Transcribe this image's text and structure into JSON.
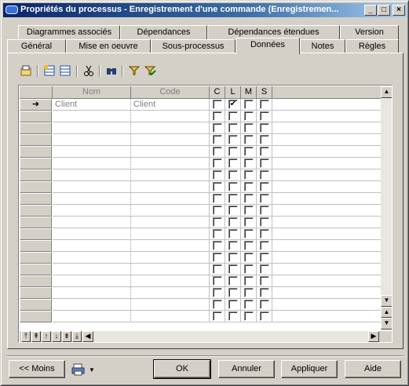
{
  "window": {
    "title": "Propriétés du processus - Enregistrement d'une commande (Enregistremen...",
    "minimize": "_",
    "maximize": "□",
    "close": "×"
  },
  "tabs": {
    "row1": [
      "Diagrammes associés",
      "Dépendances",
      "Dépendances étendues",
      "Version"
    ],
    "row2": [
      "Général",
      "Mise en oeuvre",
      "Sous-processus",
      "Données",
      "Notes",
      "Règles"
    ],
    "active": "Données"
  },
  "toolbar": {
    "icons": [
      "properties-icon",
      "add-rows-icon",
      "insert-row-icon",
      "cut-icon",
      "find-icon",
      "filter-icon",
      "check-filter-icon"
    ]
  },
  "grid": {
    "columns": {
      "nom": "Nom",
      "code": "Code",
      "c": "C",
      "l": "L",
      "m": "M",
      "s": "S"
    },
    "rows": [
      {
        "marker": "➜",
        "nom": "Client",
        "code": "Client",
        "c": false,
        "l": true,
        "m": false,
        "s": false
      }
    ],
    "empty_rows": 18
  },
  "buttons": {
    "less": "<< Moins",
    "ok": "OK",
    "cancel": "Annuler",
    "apply": "Appliquer",
    "help": "Aide"
  }
}
